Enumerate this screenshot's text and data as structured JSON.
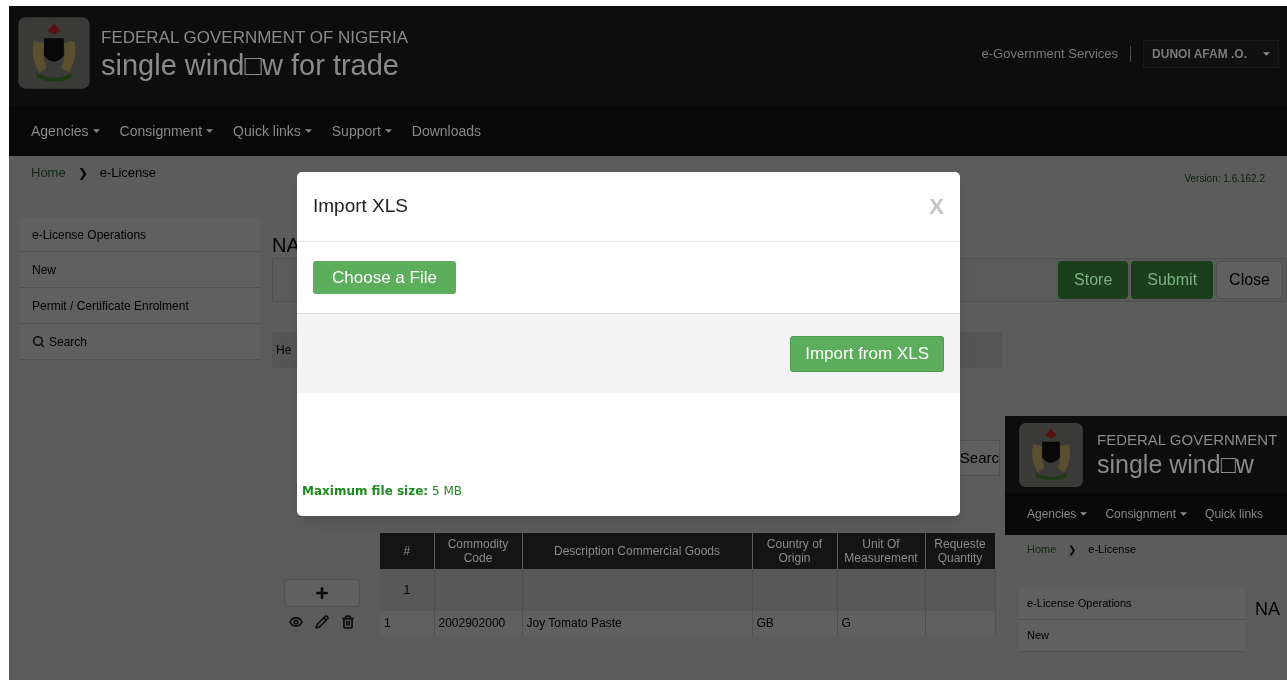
{
  "header": {
    "agency": "FEDERAL GOVERNMENT OF NIGERIA",
    "product": "single wind□w for trade",
    "services_link": "e-Government Services",
    "user": "DUNOI AFAM .O."
  },
  "nav": [
    {
      "label": "Agencies",
      "dropdown": true
    },
    {
      "label": "Consignment",
      "dropdown": true
    },
    {
      "label": "Quick links",
      "dropdown": true
    },
    {
      "label": "Support",
      "dropdown": true
    },
    {
      "label": "Downloads",
      "dropdown": false
    }
  ],
  "breadcrumb": [
    "Home",
    "❯",
    "e-License"
  ],
  "version": "Version: 1.6.162.2",
  "sidebar": {
    "title": "e-License Operations",
    "items": [
      {
        "label": "New",
        "kind": "plain"
      },
      {
        "label": "Permit / Certificate Enrolment",
        "kind": "plain"
      },
      {
        "label": "Search",
        "kind": "search"
      }
    ]
  },
  "page_title": "NA",
  "toolbar": [
    {
      "label": "Store",
      "kind": "primary"
    },
    {
      "label": "Submit",
      "kind": "primary"
    },
    {
      "label": "Close",
      "kind": "default"
    }
  ],
  "tab": "He",
  "search_button": "Searc",
  "table": {
    "columns": [
      "#",
      "Commodity Code",
      "Description Commercial Goods",
      "Country of Origin",
      "Unit Of Measurement",
      "Requeste Quantity"
    ],
    "rows": [
      {
        "kind": "new",
        "cells": [
          "1",
          "",
          "",
          "",
          "",
          ""
        ]
      },
      {
        "kind": "item",
        "cells": [
          "1",
          "2002902000",
          "Joy Tomato Paste",
          "GB",
          "G",
          ""
        ]
      }
    ]
  },
  "modal": {
    "title": "Import XLS",
    "close": "X",
    "choose_button": "Choose a File",
    "import_button": "Import from  XLS",
    "note": "**Maximum file size:** 5 MB"
  },
  "inset": {
    "agency": "FEDERAL GOVERNMENT",
    "product": "single wind□w",
    "nav": [
      {
        "label": "Agencies",
        "dropdown": true
      },
      {
        "label": "Consignment",
        "dropdown": true
      },
      {
        "label": "Quick links",
        "dropdown": false
      }
    ],
    "breadcrumb": [
      "Home",
      "❯",
      "e-License"
    ],
    "sidebar": [
      "e-License Operations",
      "New"
    ],
    "page_title": "NA"
  }
}
